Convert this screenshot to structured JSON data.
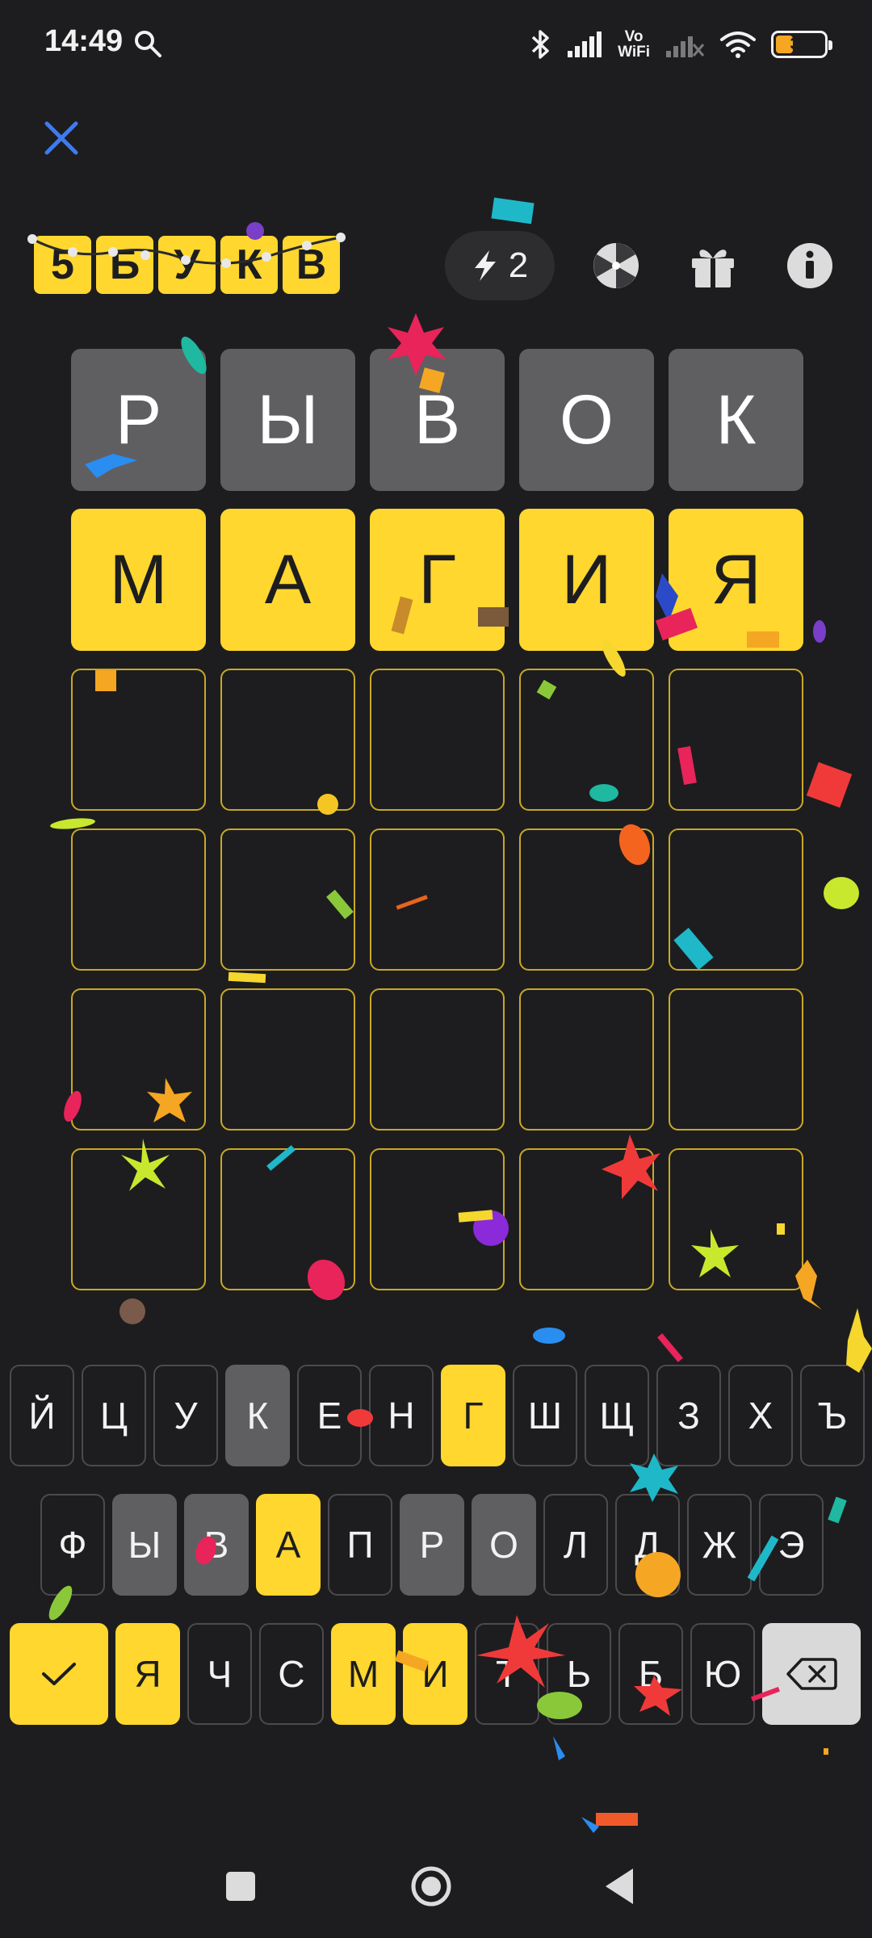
{
  "status_bar": {
    "time": "14:49",
    "vowifi_top": "Vo",
    "vowifi_bottom": "WiFi",
    "battery_level": "36",
    "battery_fraction": 0.36,
    "icons": [
      "search-icon",
      "bluetooth-icon",
      "signal-icon",
      "signal-no-service-icon",
      "wifi-icon",
      "battery-icon"
    ]
  },
  "header": {
    "close_icon": "close-icon",
    "logo_letters": [
      "5",
      "Б",
      "У",
      "К",
      "В"
    ],
    "hint_count": "2",
    "hint_icon": "lightning-icon",
    "wheel_icon": "fortune-wheel-icon",
    "gift_icon": "gift-icon",
    "info_icon": "info-icon"
  },
  "board": {
    "rows": [
      {
        "letters": [
          "Р",
          "Ы",
          "В",
          "О",
          "К"
        ],
        "states": [
          "absent",
          "absent",
          "absent",
          "absent",
          "absent"
        ]
      },
      {
        "letters": [
          "М",
          "А",
          "Г",
          "И",
          "Я"
        ],
        "states": [
          "correct",
          "correct",
          "correct",
          "correct",
          "correct"
        ]
      },
      {
        "letters": [
          "",
          "",
          "",
          "",
          ""
        ],
        "states": [
          "empty",
          "empty",
          "empty",
          "empty",
          "empty"
        ]
      },
      {
        "letters": [
          "",
          "",
          "",
          "",
          ""
        ],
        "states": [
          "empty",
          "empty",
          "empty",
          "empty",
          "empty"
        ]
      },
      {
        "letters": [
          "",
          "",
          "",
          "",
          ""
        ],
        "states": [
          "empty",
          "empty",
          "empty",
          "empty",
          "empty"
        ]
      },
      {
        "letters": [
          "",
          "",
          "",
          "",
          ""
        ],
        "states": [
          "empty",
          "empty",
          "empty",
          "empty",
          "empty"
        ]
      }
    ]
  },
  "keyboard": {
    "row1": [
      {
        "label": "Й",
        "state": "unused"
      },
      {
        "label": "Ц",
        "state": "unused"
      },
      {
        "label": "У",
        "state": "unused"
      },
      {
        "label": "К",
        "state": "absent"
      },
      {
        "label": "Е",
        "state": "unused"
      },
      {
        "label": "Н",
        "state": "unused"
      },
      {
        "label": "Г",
        "state": "correct"
      },
      {
        "label": "Ш",
        "state": "unused"
      },
      {
        "label": "Щ",
        "state": "unused"
      },
      {
        "label": "З",
        "state": "unused"
      },
      {
        "label": "Х",
        "state": "unused"
      },
      {
        "label": "Ъ",
        "state": "unused"
      }
    ],
    "row2": [
      {
        "label": "Ф",
        "state": "unused"
      },
      {
        "label": "Ы",
        "state": "absent"
      },
      {
        "label": "В",
        "state": "absent"
      },
      {
        "label": "А",
        "state": "correct"
      },
      {
        "label": "П",
        "state": "unused"
      },
      {
        "label": "Р",
        "state": "absent"
      },
      {
        "label": "О",
        "state": "absent"
      },
      {
        "label": "Л",
        "state": "unused"
      },
      {
        "label": "Д",
        "state": "unused"
      },
      {
        "label": "Ж",
        "state": "unused"
      },
      {
        "label": "Э",
        "state": "unused"
      }
    ],
    "row3": [
      {
        "label": "Я",
        "state": "correct"
      },
      {
        "label": "Ч",
        "state": "unused"
      },
      {
        "label": "С",
        "state": "unused"
      },
      {
        "label": "М",
        "state": "correct"
      },
      {
        "label": "И",
        "state": "correct"
      },
      {
        "label": "Т",
        "state": "unused"
      },
      {
        "label": "Ь",
        "state": "unused"
      },
      {
        "label": "Б",
        "state": "unused"
      },
      {
        "label": "Ю",
        "state": "unused"
      }
    ],
    "enter_icon": "checkmark-icon",
    "backspace_icon": "backspace-icon"
  },
  "navbar": {
    "icons": [
      "recent-apps-icon",
      "home-icon",
      "back-icon"
    ]
  },
  "colors": {
    "background": "#1d1d1f",
    "correct": "#ffd72e",
    "absent": "#5f5f62",
    "empty_border": "#c9a827",
    "close_accent": "#3d7bf0"
  }
}
